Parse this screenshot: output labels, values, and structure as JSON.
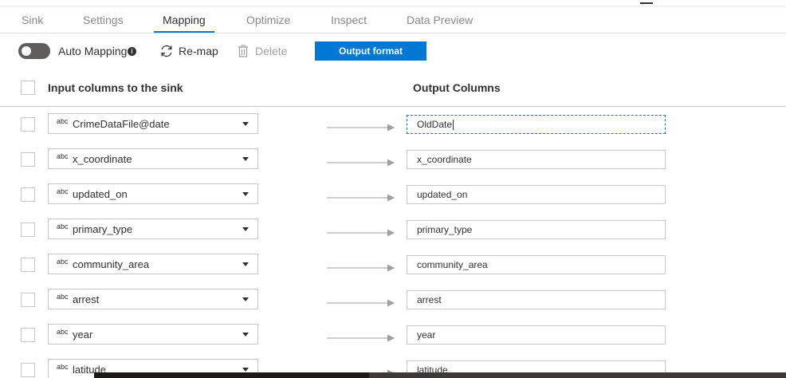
{
  "tabs": [
    {
      "label": "Sink"
    },
    {
      "label": "Settings"
    },
    {
      "label": "Mapping"
    },
    {
      "label": "Optimize"
    },
    {
      "label": "Inspect"
    },
    {
      "label": "Data Preview"
    }
  ],
  "active_tab": "Mapping",
  "toolbar": {
    "auto_mapping_label": "Auto Mapping",
    "auto_mapping_on": false,
    "remap_label": "Re-map",
    "delete_label": "Delete",
    "output_format_label": "Output format"
  },
  "columns": {
    "input_header": "Input columns to the sink",
    "output_header": "Output Columns"
  },
  "type_badge": "abc",
  "rows": [
    {
      "input": "CrimeDataFile@date",
      "output": "OldDate"
    },
    {
      "input": "x_coordinate",
      "output": "x_coordinate"
    },
    {
      "input": "updated_on",
      "output": "updated_on"
    },
    {
      "input": "primary_type",
      "output": "primary_type"
    },
    {
      "input": "community_area",
      "output": "community_area"
    },
    {
      "input": "arrest",
      "output": "arrest"
    },
    {
      "input": "year",
      "output": "year"
    },
    {
      "input": "latitude",
      "output": "latitude"
    }
  ],
  "colors": {
    "accent": "#0078d4",
    "toggle_off": "#605e5c"
  }
}
